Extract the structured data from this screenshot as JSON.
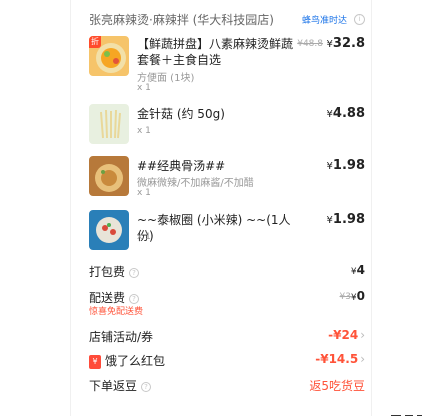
{
  "shop": {
    "name": "张亮麻辣烫·麻辣拌 (华大科技园店)",
    "delivery_tag": "蜂鸟准时达",
    "info_icon": "i"
  },
  "items": [
    {
      "name": "【鲜蔬拼盘】八素麻辣烫鲜蔬套餐＋主食自选",
      "spec": "方便面 (1块)",
      "qty": "x 1",
      "original_price": "¥48.8",
      "currency": "¥",
      "price": "32.8",
      "badge": "折",
      "thumb_colors": [
        "#f6a623",
        "#f2e0a8"
      ]
    },
    {
      "name": "金针菇 (约 50g)",
      "spec": "",
      "qty": "x 1",
      "currency": "¥",
      "price": "4.88",
      "thumb_colors": [
        "#e9d89a",
        "#f5efd0"
      ]
    },
    {
      "name": "##经典骨汤##",
      "spec": "微麻微辣/不加麻酱/不加醋",
      "qty": "x 1",
      "currency": "¥",
      "price": "1.98",
      "thumb_colors": [
        "#c98a3c",
        "#e8c07a"
      ]
    },
    {
      "name": "~~泰椒圈 (小米辣) ~~(1人份)",
      "spec": "",
      "qty": "x 1",
      "currency": "¥",
      "price": "1.98",
      "thumb_colors": [
        "#2a7fb8",
        "#d94a3a"
      ]
    }
  ],
  "fees": {
    "packing_label": "打包费",
    "packing_currency": "¥",
    "packing_value": "4",
    "delivery_label": "配送费",
    "delivery_original": "¥3",
    "delivery_currency": "¥",
    "delivery_value": "0",
    "delivery_note": "惊喜免配送费",
    "q_icon": "?"
  },
  "discounts": {
    "store_label": "店铺活动/券",
    "store_value": "-¥24",
    "redpack_label": "饿了么红包",
    "redpack_icon": "¥",
    "redpack_value": "-¥14.5",
    "beans_label": "下单返豆",
    "beans_value": "返5吃货豆",
    "chevron": "›"
  },
  "colors": {
    "accent_red": "#ff5339",
    "delivery_blue": "#1a73e8"
  }
}
